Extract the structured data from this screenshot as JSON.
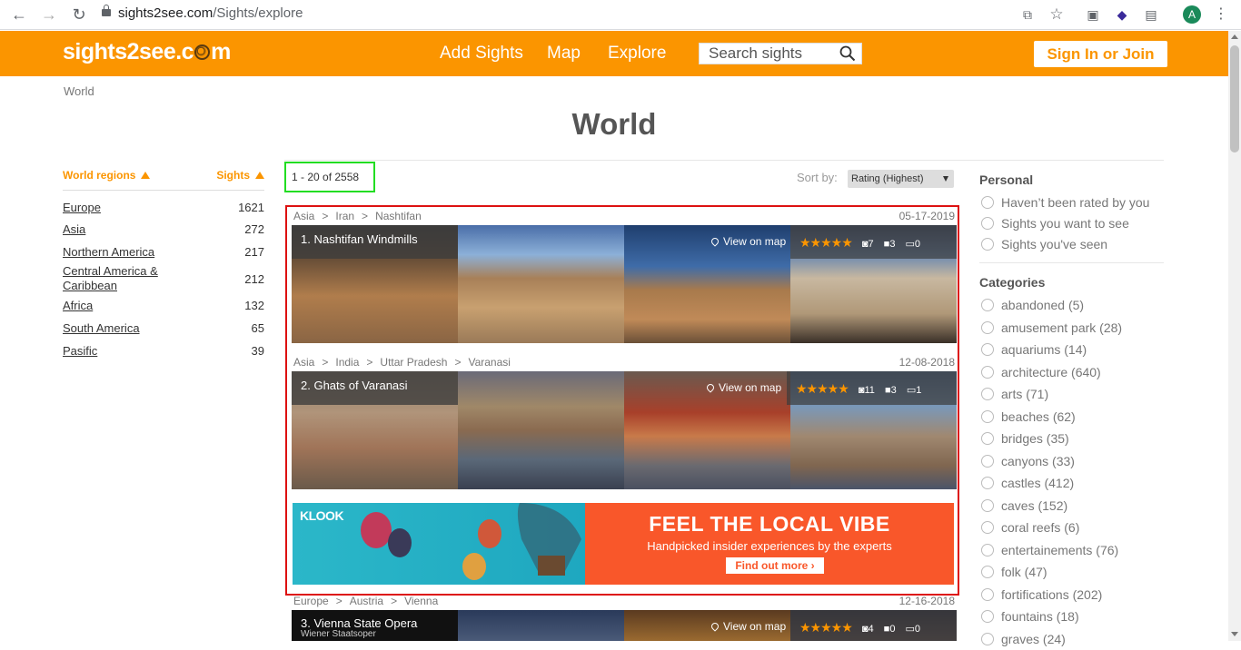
{
  "browser": {
    "url_domain": "sights2see.com",
    "url_path": "/Sights/explore",
    "profile_initial": "A"
  },
  "header": {
    "logo_text_a": "sights2see.c",
    "logo_text_b": "m",
    "nav": [
      "Add Sights",
      "Map",
      "Explore"
    ],
    "search_placeholder": "Search sights",
    "signin": "Sign In or Join",
    "brand_color": "#fb9500"
  },
  "breadcrumb": "World",
  "page_title": "World",
  "regions": {
    "header_left": "World regions",
    "header_right": "Sights",
    "items": [
      {
        "name": "Europe",
        "count": "1621"
      },
      {
        "name": "Asia",
        "count": "272"
      },
      {
        "name": "Northern America",
        "count": "217"
      },
      {
        "name": "Central America & Caribbean",
        "count": "212"
      },
      {
        "name": "Africa",
        "count": "132"
      },
      {
        "name": "South America",
        "count": "65"
      },
      {
        "name": "Pasific",
        "count": "39"
      }
    ]
  },
  "results": {
    "count_text": "1 - 20 of 2558",
    "sort_label": "Sort by:",
    "sort_value": "Rating (Highest)"
  },
  "sights": [
    {
      "location": [
        "Asia",
        "Iran",
        "Nashtifan"
      ],
      "date": "05-17-2019",
      "title": "1.  Nashtifan Windmills",
      "subtitle": "",
      "view_map": "View on map",
      "photos": "7",
      "videos": "3",
      "comments": "0"
    },
    {
      "location": [
        "Asia",
        "India",
        "Uttar Pradesh",
        "Varanasi"
      ],
      "date": "12-08-2018",
      "title": "2.  Ghats of Varanasi",
      "subtitle": "",
      "view_map": "View on map",
      "photos": "11",
      "videos": "3",
      "comments": "1"
    },
    {
      "location": [
        "Europe",
        "Austria",
        "Vienna"
      ],
      "date": "12-16-2018",
      "title": "3.  Vienna State Opera",
      "subtitle": "Wiener Staatsoper",
      "view_map": "View on map",
      "photos": "4",
      "videos": "0",
      "comments": "0"
    }
  ],
  "ad": {
    "brand": "KLOOK",
    "headline": "FEEL THE LOCAL VIBE",
    "subline": "Handpicked insider experiences by the experts",
    "cta": "Find out more ›"
  },
  "sidebar": {
    "personal_title": "Personal",
    "personal": [
      "Haven’t been rated by you",
      "Sights you want to see",
      "Sights you've seen"
    ],
    "categories_title": "Categories",
    "categories": [
      "abandoned (5)",
      "amusement park (28)",
      "aquariums (14)",
      "architecture (640)",
      "arts (71)",
      "beaches (62)",
      "bridges (35)",
      "canyons (33)",
      "castles (412)",
      "caves (152)",
      "coral reefs (6)",
      "entertainements (76)",
      "folk (47)",
      "fortifications (202)",
      "fountains (18)",
      "graves (24)"
    ]
  }
}
